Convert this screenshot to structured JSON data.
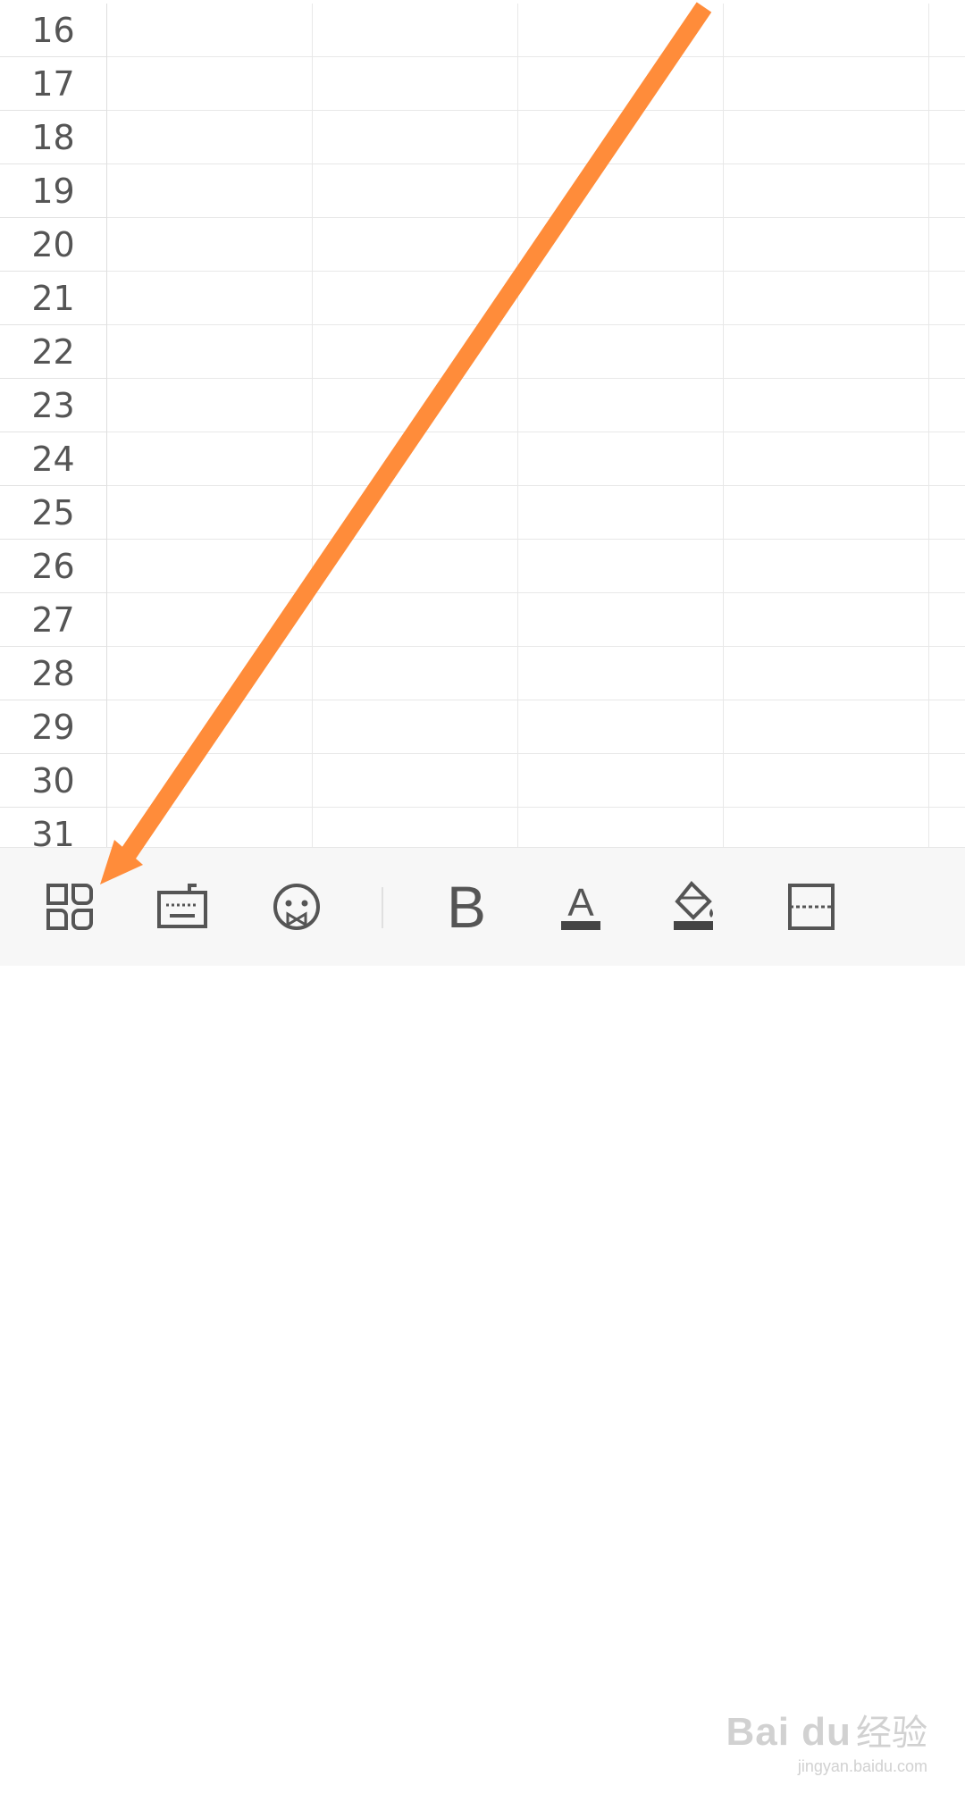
{
  "sheet": {
    "row_numbers": [
      "16",
      "17",
      "18",
      "19",
      "20",
      "21",
      "22",
      "23",
      "24",
      "25",
      "26",
      "27",
      "28",
      "29",
      "30",
      "31"
    ]
  },
  "toolbar": {
    "items": [
      {
        "name": "apps-grid",
        "icon": "apps-grid-icon"
      },
      {
        "name": "keyboard",
        "icon": "keyboard-icon"
      },
      {
        "name": "emoji",
        "icon": "emoji-icon"
      },
      {
        "name": "bold",
        "icon": "bold-icon",
        "label": "B"
      },
      {
        "name": "font-color",
        "icon": "font-color-icon",
        "label": "A"
      },
      {
        "name": "fill-color",
        "icon": "fill-bucket-icon"
      },
      {
        "name": "border",
        "icon": "border-icon"
      }
    ]
  },
  "annotation": {
    "color": "#FF8C3A",
    "points_to": "apps-grid-button"
  },
  "watermark": {
    "logo": "Bai du",
    "text": "经验",
    "url": "jingyan.baidu.com"
  },
  "colors": {
    "icon": "#555555",
    "grid": "#e8e8e8",
    "toolbar_bg": "#f7f7f7"
  }
}
